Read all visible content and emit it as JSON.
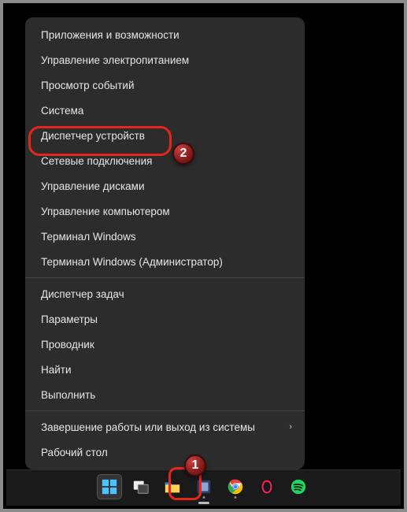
{
  "menu": {
    "groups": [
      [
        "Приложения и возможности",
        "Управление электропитанием",
        "Просмотр событий",
        "Система",
        "Диспетчер устройств",
        "Сетевые подключения",
        "Управление дисками",
        "Управление компьютером",
        "Терминал Windows",
        "Терминал Windows (Администратор)"
      ],
      [
        "Диспетчер задач",
        "Параметры",
        "Проводник",
        "Найти",
        "Выполнить"
      ],
      [
        "Завершение работы или выход из системы",
        "Рабочий стол"
      ]
    ],
    "submenu_items": [
      "Завершение работы или выход из системы"
    ]
  },
  "annotations": {
    "badge1": "1",
    "badge2": "2"
  },
  "taskbar": {
    "icons": [
      "start",
      "task-view",
      "explorer",
      "settings",
      "chrome",
      "opera",
      "spotify"
    ]
  }
}
